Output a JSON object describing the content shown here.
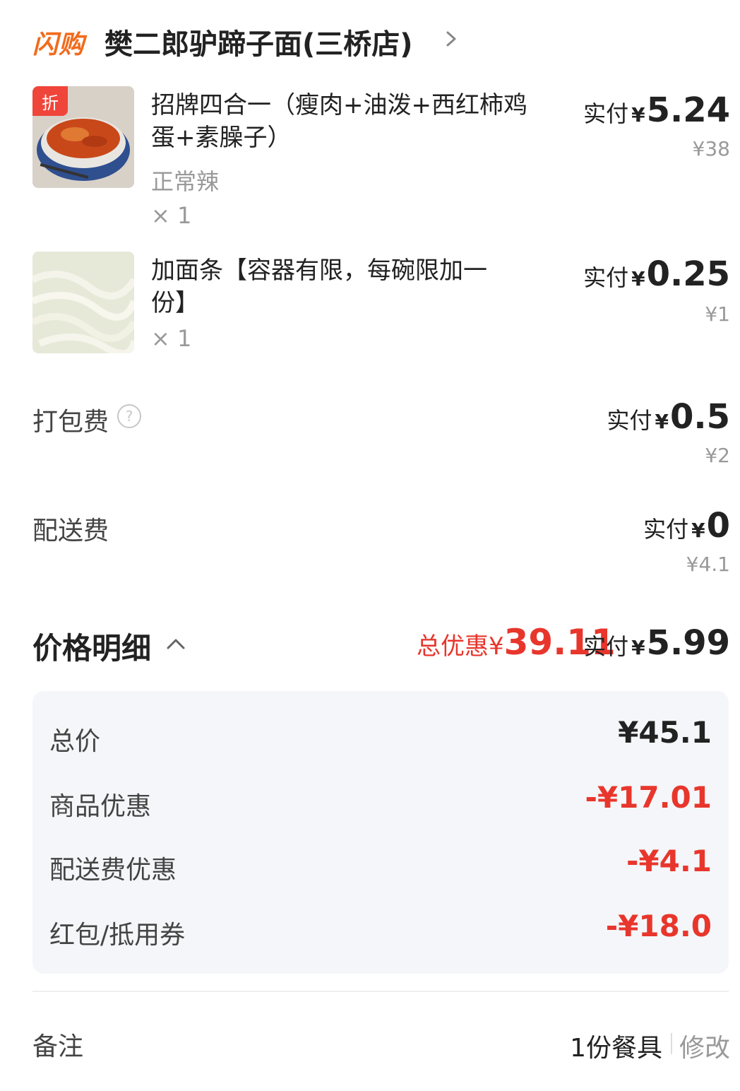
{
  "header": {
    "brand": "闪购",
    "store_name": "樊二郎驴蹄子面(三桥店)"
  },
  "items": [
    {
      "discount_tag": "折",
      "name_line1": "招牌四合一（瘦肉+油泼+西红柿鸡",
      "name_line2": "蛋+素臊子）",
      "spec": "正常辣",
      "qty": "× 1",
      "pay_label": "实付",
      "yen": "¥",
      "pay_amount": "5.24",
      "original_price": "¥38"
    },
    {
      "name_line1": "加面条【容器有限，每碗限加一",
      "name_line2": "份】",
      "qty": "× 1",
      "pay_label": "实付",
      "yen": "¥",
      "pay_amount": "0.25",
      "original_price": "¥1"
    }
  ],
  "fees": [
    {
      "label": "打包费",
      "help": "?",
      "pay_label": "实付",
      "yen": "¥",
      "pay_amount": "0.5",
      "original_price": "¥2"
    },
    {
      "label": "配送费",
      "pay_label": "实付",
      "yen": "¥",
      "pay_amount": "0",
      "original_price": "¥4.1"
    }
  ],
  "price_detail": {
    "title": "价格明细",
    "total_discount_label": "总优惠",
    "total_discount_yen": "¥",
    "total_discount_amount": "39.11",
    "pay_label": "实付",
    "pay_yen": "¥",
    "pay_amount": "5.99",
    "rows": [
      {
        "label": "总价",
        "value": "¥45.1"
      },
      {
        "label": "商品优惠",
        "value": "-¥17.01"
      },
      {
        "label": "配送费优惠",
        "value": "-¥4.1"
      },
      {
        "label": "红包/抵用券",
        "value": "-¥18.0"
      }
    ]
  },
  "remark": {
    "label": "备注",
    "value": "1份餐具",
    "edit": "修改"
  },
  "colors": {
    "brand": "#f26b1d",
    "discount_red": "#e8362c",
    "panel_bg": "#f4f6f9"
  }
}
